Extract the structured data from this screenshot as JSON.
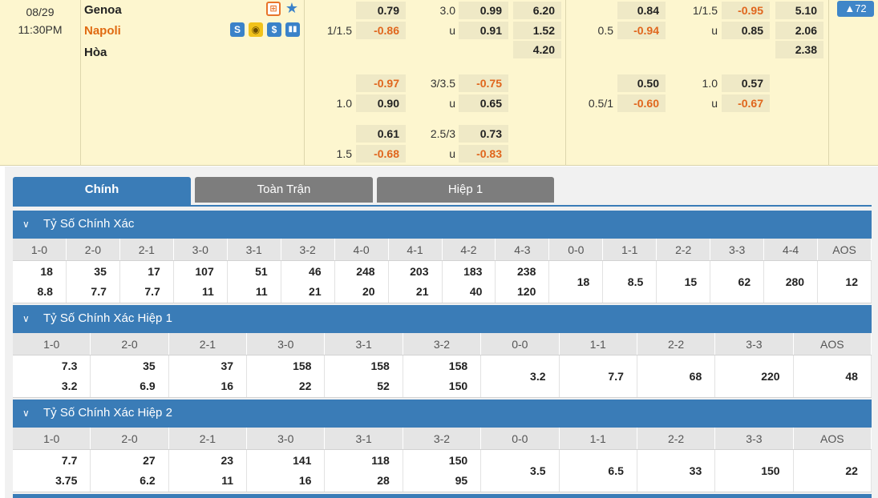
{
  "match": {
    "date": "08/29",
    "time": "11:30PM",
    "home": "Genoa",
    "away": "Napoli",
    "draw": "Hòa",
    "more_count": "▲72"
  },
  "odds": {
    "ft_hdp": [
      {
        "line": "",
        "home": "0.79",
        "away": "-0.86",
        "away_line": "1/1.5"
      },
      {
        "line": "",
        "home": "-0.97",
        "away": "0.90",
        "away_line": "1.0"
      },
      {
        "line": "",
        "home": "0.61",
        "away": "-0.68",
        "away_line": "1.5"
      }
    ],
    "ft_ou": [
      {
        "line": "3.0",
        "over": "0.99",
        "u": "u",
        "under": "0.91"
      },
      {
        "line": "3/3.5",
        "over": "-0.75",
        "u": "u",
        "under": "0.65"
      },
      {
        "line": "2.5/3",
        "over": "0.73",
        "u": "u",
        "under": "-0.83"
      }
    ],
    "ft_1x2": [
      "6.20",
      "1.52",
      "4.20"
    ],
    "h1_hdp": [
      {
        "home": "0.84",
        "away": "-0.94",
        "away_line": "0.5"
      },
      {
        "home": "0.50",
        "away": "-0.60",
        "away_line": "0.5/1"
      }
    ],
    "h1_ou": [
      {
        "line": "1/1.5",
        "over": "-0.95",
        "u": "u",
        "under": "0.85"
      },
      {
        "line": "1.0",
        "over": "0.57",
        "u": "u",
        "under": "-0.67"
      }
    ],
    "h1_1x2": [
      "5.10",
      "2.06",
      "2.38"
    ]
  },
  "tabs": [
    "Chính",
    "Toàn Trận",
    "Hiệp 1"
  ],
  "sections": [
    {
      "title": "Tỷ Số Chính Xác",
      "headers": [
        "1-0",
        "2-0",
        "2-1",
        "3-0",
        "3-1",
        "3-2",
        "4-0",
        "4-1",
        "4-2",
        "4-3",
        "0-0",
        "1-1",
        "2-2",
        "3-3",
        "4-4",
        "AOS"
      ],
      "top": [
        "18",
        "35",
        "17",
        "107",
        "51",
        "46",
        "248",
        "203",
        "183",
        "238",
        "18",
        "8.5",
        "15",
        "62",
        "280",
        "12"
      ],
      "bottom": [
        "8.8",
        "7.7",
        "7.7",
        "11",
        "11",
        "21",
        "20",
        "21",
        "40",
        "120",
        "",
        "",
        "",
        "",
        "",
        ""
      ]
    },
    {
      "title": "Tỷ Số Chính Xác Hiệp 1",
      "headers": [
        "1-0",
        "2-0",
        "2-1",
        "3-0",
        "3-1",
        "3-2",
        "0-0",
        "1-1",
        "2-2",
        "3-3",
        "AOS"
      ],
      "top": [
        "7.3",
        "35",
        "37",
        "158",
        "158",
        "158",
        "3.2",
        "7.7",
        "68",
        "220",
        "48"
      ],
      "bottom": [
        "3.2",
        "6.9",
        "16",
        "22",
        "52",
        "150",
        "",
        "",
        "",
        "",
        ""
      ]
    },
    {
      "title": "Tỷ Số Chính Xác Hiệp 2",
      "headers": [
        "1-0",
        "2-0",
        "2-1",
        "3-0",
        "3-1",
        "3-2",
        "0-0",
        "1-1",
        "2-2",
        "3-3",
        "AOS"
      ],
      "top": [
        "7.7",
        "27",
        "23",
        "141",
        "118",
        "150",
        "3.5",
        "6.5",
        "33",
        "150",
        "22"
      ],
      "bottom": [
        "3.75",
        "6.2",
        "11",
        "16",
        "28",
        "95",
        "",
        "",
        "",
        "",
        ""
      ]
    }
  ],
  "icons": {
    "chevron": "chevron-down-icon",
    "star": "star-icon",
    "colors": {
      "accent": "#3a7cb7",
      "negative": "#e0661d",
      "odds_bg": "#fdf6cf"
    }
  }
}
